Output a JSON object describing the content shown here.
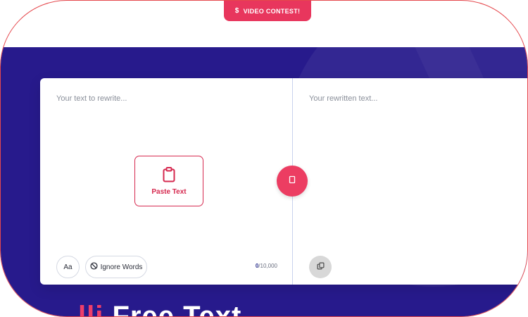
{
  "badge": {
    "icon": "dollar-icon",
    "label": "VIDEO CONTEST!"
  },
  "editor": {
    "input_placeholder": "Your text to rewrite...",
    "output_placeholder": "Your rewritten text...",
    "paste_label": "Paste Text",
    "case_label": "Aa",
    "ignore_words_label": "Ignore Words",
    "char_count": "0",
    "char_limit": "/10,000"
  },
  "headline": {
    "accent": "lli",
    "text": "Free Text"
  },
  "colors": {
    "accent": "#e8365d",
    "band": "#271a8c",
    "frame_outline": "#e5484d"
  }
}
